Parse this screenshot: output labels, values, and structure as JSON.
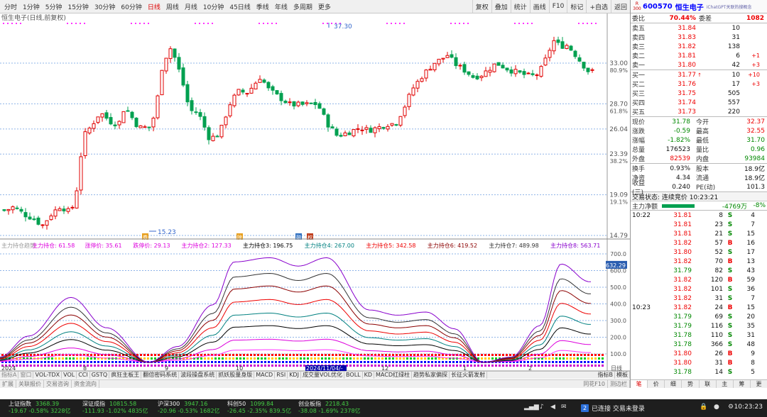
{
  "toolbar": {
    "periods": [
      "分时",
      "1分钟",
      "5分钟",
      "15分钟",
      "30分钟",
      "60分钟",
      "日线",
      "周线",
      "月线",
      "10分钟",
      "45日线",
      "季线",
      "年线",
      "多周期",
      "更多"
    ],
    "active_period": "日线",
    "tools": [
      "复权",
      "叠加",
      "统计",
      "画线",
      "F10",
      "标记",
      "+自选",
      "返回"
    ]
  },
  "chart": {
    "title": "恒生电子(日线,前复权)",
    "price_labels": [
      {
        "v": "33.00",
        "s": "80.9%"
      },
      {
        "v": "28.70",
        "s": "61.8%"
      },
      {
        "v": "26.04",
        "s": ""
      },
      {
        "v": "23.39",
        "s": "38.2%"
      },
      {
        "v": "19.09",
        "s": "19.1%"
      },
      {
        "v": "14.79",
        "s": ""
      }
    ],
    "high_label": "37.30",
    "low_label": "15.23",
    "indicator_legend": [
      {
        "t": "主力持仓趋势",
        "c": "#999999"
      },
      {
        "t": "主力持仓: 61.58",
        "c": "#dd00dd"
      },
      {
        "t": "涨停价: 35.61",
        "c": "#dd00dd"
      },
      {
        "t": "跌停价: 29.13",
        "c": "#dd00dd"
      },
      {
        "t": "主力持仓2: 127.33",
        "c": "#dd00dd"
      },
      {
        "t": "主力持仓3: 196.75",
        "c": "#000000"
      },
      {
        "t": "主力持仓4: 267.00",
        "c": "#008080"
      },
      {
        "t": "主力持仓5: 342.58",
        "c": "#ee0000"
      },
      {
        "t": "主力持仓6: 419.52",
        "c": "#8b0000"
      },
      {
        "t": "主力持仓7: 489.98",
        "c": "#333333"
      },
      {
        "t": "主力持仓8: 563.71",
        "c": "#8800cc"
      }
    ],
    "ind_labels": [
      "700.0",
      "600.0",
      "500.0",
      "400.0",
      "300.0",
      "200.0",
      "100.0"
    ],
    "ind_current": "632.29",
    "date_labels": [
      {
        "t": "2024",
        "hl": false
      },
      {
        "t": "8",
        "hl": false
      },
      {
        "t": "9",
        "hl": false
      },
      {
        "t": "10",
        "hl": false
      },
      {
        "t": "2024/11/04/-",
        "hl": true
      },
      {
        "t": "12",
        "hl": false
      },
      {
        "t": "1",
        "hl": false
      },
      {
        "t": "2",
        "hl": false
      }
    ],
    "period_tag": "日线",
    "markers": [
      "券",
      "除",
      "融",
      "权"
    ]
  },
  "indicator_tabs": [
    "指标A",
    "窗口",
    "VOL-TDX",
    "VOL",
    "CCI",
    "GSTQ",
    "疯狂主板王",
    "翻倍密码系统",
    "波段操盘系统",
    "抓妖股量身版",
    "MACD",
    "RSI",
    "KDJ",
    "成交量VOL优化",
    "BOLL",
    "KD",
    "MACD红绿柱",
    "趋势私家偏探",
    "长征火箭发射"
  ],
  "indicator_tabs_right": [
    "指标B",
    "模板"
  ],
  "ext_tabs": [
    "扩展",
    "关联报价",
    "交易咨询",
    "资金流向"
  ],
  "ext_tabs_right": [
    "同花F10",
    "测边栏"
  ],
  "panel": {
    "code": "600570",
    "name": "恒生电子",
    "link": "iChatGPT关联热搜概念",
    "logo_top": "R",
    "logo_bottom": "300",
    "webi_label": "委比",
    "webi": "70.44%",
    "weicha_label": "委差",
    "weicha": "1082",
    "asks": [
      {
        "l": "卖五",
        "p": "31.84",
        "v": "10",
        "a": "",
        "c": ""
      },
      {
        "l": "卖四",
        "p": "31.83",
        "v": "31",
        "a": "",
        "c": ""
      },
      {
        "l": "卖三",
        "p": "31.82",
        "v": "138",
        "a": "",
        "c": ""
      },
      {
        "l": "卖二",
        "p": "31.81",
        "v": "6",
        "a": "",
        "c": "+1"
      },
      {
        "l": "卖一",
        "p": "31.80",
        "v": "42",
        "a": "",
        "c": "+3"
      }
    ],
    "bids": [
      {
        "l": "买一",
        "p": "31.77",
        "v": "10",
        "a": "↑",
        "c": "+10"
      },
      {
        "l": "买二",
        "p": "31.76",
        "v": "17",
        "a": "",
        "c": "+3"
      },
      {
        "l": "买三",
        "p": "31.75",
        "v": "505",
        "a": "",
        "c": ""
      },
      {
        "l": "买四",
        "p": "31.74",
        "v": "557",
        "a": "",
        "c": ""
      },
      {
        "l": "买五",
        "p": "31.73",
        "v": "220",
        "a": "",
        "c": ""
      }
    ],
    "quote": [
      {
        "l1": "现价",
        "v1": "31.78",
        "c1": "grn",
        "l2": "今开",
        "v2": "32.37",
        "c2": "red"
      },
      {
        "l1": "涨跌",
        "v1": "-0.59",
        "c1": "grn",
        "l2": "最高",
        "v2": "32.55",
        "c2": "red"
      },
      {
        "l1": "涨幅",
        "v1": "-1.82%",
        "c1": "grn",
        "l2": "最低",
        "v2": "31.70",
        "c2": "grn"
      },
      {
        "l1": "总量",
        "v1": "176523",
        "c1": "blk",
        "l2": "量比",
        "v2": "0.96",
        "c2": "grn"
      },
      {
        "l1": "外盘",
        "v1": "82539",
        "c1": "red",
        "l2": "内盘",
        "v2": "93984",
        "c2": "grn"
      }
    ],
    "quote2": [
      {
        "l1": "换手",
        "v1": "0.93%",
        "c1": "blk",
        "l2": "股本",
        "v2": "18.9亿",
        "c2": "blk"
      },
      {
        "l1": "净资",
        "v1": "4.34",
        "c1": "blk",
        "l2": "流通",
        "v2": "18.9亿",
        "c2": "blk"
      },
      {
        "l1": "收益(三)",
        "v1": "0.240",
        "c1": "blk",
        "l2": "PE(动)",
        "v2": "101.3",
        "c2": "blk"
      }
    ],
    "trade_status": "交易状态: 连续竞价 10:23:21",
    "flow_label": "主力净额",
    "flow_value": "-4769万",
    "flow_pct": "-8%",
    "ticks": [
      {
        "t": "10:22",
        "p": "31.81",
        "v": "8",
        "f": "S",
        "n": "4"
      },
      {
        "t": "",
        "p": "31.81",
        "v": "23",
        "f": "S",
        "n": "7"
      },
      {
        "t": "",
        "p": "31.81",
        "v": "21",
        "f": "S",
        "n": "15"
      },
      {
        "t": "",
        "p": "31.82",
        "v": "57",
        "f": "B",
        "n": "16"
      },
      {
        "t": "",
        "p": "31.80",
        "v": "52",
        "f": "S",
        "n": "17"
      },
      {
        "t": "",
        "p": "31.82",
        "v": "70",
        "f": "B",
        "n": "13"
      },
      {
        "t": "",
        "p": "31.79",
        "v": "82",
        "f": "S",
        "n": "43"
      },
      {
        "t": "",
        "p": "31.82",
        "v": "120",
        "f": "B",
        "n": "59"
      },
      {
        "t": "",
        "p": "31.82",
        "v": "101",
        "f": "S",
        "n": "36"
      },
      {
        "t": "",
        "p": "31.82",
        "v": "31",
        "f": "S",
        "n": "7"
      },
      {
        "t": "10:23",
        "p": "31.82",
        "v": "24",
        "f": "B",
        "n": "15"
      },
      {
        "t": "",
        "p": "31.79",
        "v": "69",
        "f": "S",
        "n": "20"
      },
      {
        "t": "",
        "p": "31.79",
        "v": "116",
        "f": "S",
        "n": "35"
      },
      {
        "t": "",
        "p": "31.78",
        "v": "110",
        "f": "S",
        "n": "31"
      },
      {
        "t": "",
        "p": "31.78",
        "v": "366",
        "f": "S",
        "n": "48"
      },
      {
        "t": "",
        "p": "31.80",
        "v": "26",
        "f": "B",
        "n": "9"
      },
      {
        "t": "",
        "p": "31.80",
        "v": "31",
        "f": "B",
        "n": "8"
      },
      {
        "t": "",
        "p": "31.78",
        "v": "14",
        "f": "S",
        "n": "5"
      }
    ],
    "tabs": [
      "笔",
      "价",
      "细",
      "势",
      "联",
      "主",
      "筹",
      "更"
    ]
  },
  "status": {
    "indices": [
      {
        "n": "上证指数",
        "a": "3368.39",
        "b": "-19.67  -0.58%  3228亿"
      },
      {
        "n": "深证成指",
        "a": "10815.58",
        "b": "-111.93  -1.02%  4835亿"
      },
      {
        "n": "沪深300",
        "a": "3947.16",
        "b": "-20.96  -0.53%  1682亿"
      },
      {
        "n": "科创50",
        "a": "1099.84",
        "b": "-26.45  -2.35%  839.5亿"
      },
      {
        "n": "创业板指",
        "a": "2218.43",
        "b": "-38.08  -1.69%  2378亿"
      }
    ],
    "connection": "已连接 交易未登录",
    "conn_num": "2",
    "clock": "10:23:23"
  },
  "colors": {
    "up": "#e00000",
    "down": "#00a050",
    "accent": "#0000ff"
  }
}
